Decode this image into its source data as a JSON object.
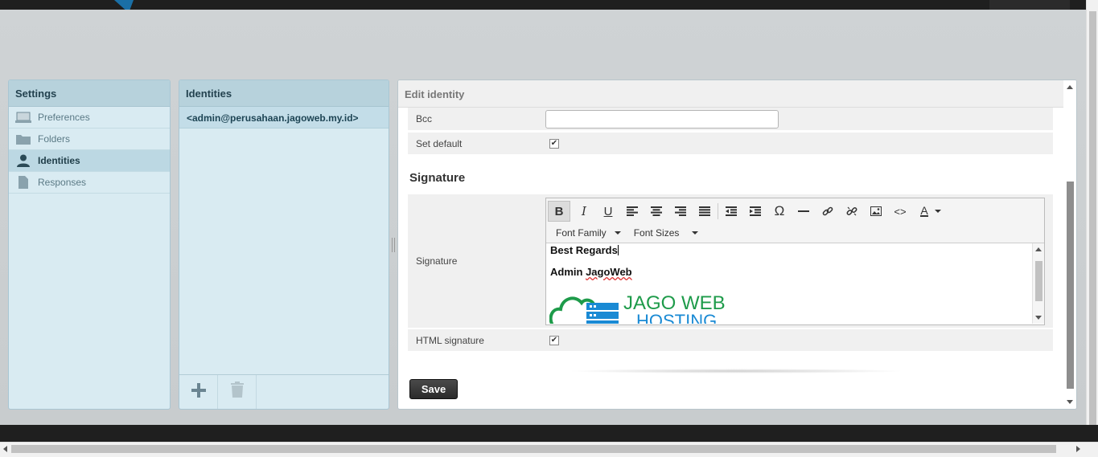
{
  "settings": {
    "title": "Settings",
    "items": [
      {
        "label": "Preferences",
        "icon": "monitor-icon",
        "active": false
      },
      {
        "label": "Folders",
        "icon": "folder-icon",
        "active": false
      },
      {
        "label": "Identities",
        "icon": "user-icon",
        "active": true
      },
      {
        "label": "Responses",
        "icon": "document-icon",
        "active": false
      }
    ]
  },
  "identities": {
    "title": "Identities",
    "list": [
      "<admin@perusahaan.jagoweb.my.id>"
    ],
    "footer": {
      "add_icon": "plus-icon",
      "delete_icon": "trash-icon"
    }
  },
  "editor": {
    "title": "Edit identity",
    "bcc_label": "Bcc",
    "bcc_value": "",
    "set_default_label": "Set default",
    "set_default_checked": true,
    "section_title": "Signature",
    "signature_label": "Signature",
    "toolbar": {
      "buttons": [
        "bold-icon",
        "italic-icon",
        "underline-icon",
        "align-left-icon",
        "align-center-icon",
        "align-right-icon",
        "align-justify-icon",
        "outdent-icon",
        "indent-icon",
        "omega-icon",
        "hr-icon",
        "link-icon",
        "unlink-icon",
        "image-icon",
        "code-icon",
        "text-color-icon"
      ],
      "font_family": "Font Family",
      "font_sizes": "Font Sizes"
    },
    "signature_body": {
      "line1": "Best Regards",
      "line2_a": "Admin ",
      "line2_b": "JagoWeb",
      "logo_line1": "JAGO WEB",
      "logo_line2": "HOSTING"
    },
    "html_signature_label": "HTML signature",
    "html_signature_checked": true,
    "save_label": "Save"
  },
  "colors": {
    "panel_bg": "#d9ebf2",
    "panel_header": "#b7d2dc",
    "logo_green": "#1e9b4a",
    "logo_blue": "#1a8ad4"
  }
}
